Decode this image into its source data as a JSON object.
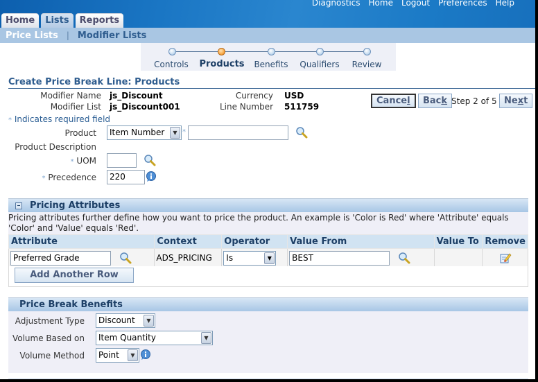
{
  "global_links": [
    "Diagnostics",
    "Home",
    "Logout",
    "Preferences",
    "Help"
  ],
  "tabs": [
    {
      "label": "Home",
      "active": false
    },
    {
      "label": "Lists",
      "active": true
    },
    {
      "label": "Reports",
      "active": false
    }
  ],
  "subnav": {
    "items": [
      {
        "label": "Price Lists",
        "active": true
      },
      {
        "label": "Modifier Lists",
        "active": false
      }
    ],
    "separator": "|"
  },
  "train": {
    "steps": [
      "Controls",
      "Products",
      "Benefits",
      "Qualifiers",
      "Review"
    ],
    "current_index": 1
  },
  "page": {
    "title": "Create Price Break Line: Products",
    "modifier_name_label": "Modifier Name",
    "modifier_name": "js_Discount",
    "modifier_list_label": "Modifier List",
    "modifier_list": "js_Discount001",
    "currency_label": "Currency",
    "currency": "USD",
    "line_number_label": "Line Number",
    "line_number": "511759",
    "required_note": "Indicates required field",
    "required_star": "*"
  },
  "actions": {
    "cancel": {
      "pre": "Cance",
      "accel": "l",
      "post": ""
    },
    "back": {
      "pre": "Bac",
      "accel": "k",
      "post": ""
    },
    "step_text": "Step 2 of 5",
    "next": {
      "pre": "Ne",
      "accel": "x",
      "post": "t"
    }
  },
  "form": {
    "product_label": "Product",
    "product_type": "Item Number",
    "product_value": "",
    "product_description_label": "Product Description",
    "uom_label": "UOM",
    "uom_value": "",
    "precedence_label": "Precedence",
    "precedence_value": "220"
  },
  "pricing_attributes": {
    "title": "Pricing Attributes",
    "description": "Pricing attributes further define how you want to price the product. An example is 'Color is Red' where 'Attribute' equals 'Color' and 'Value' equals 'Red'.",
    "columns": [
      "Attribute",
      "Context",
      "Operator",
      "Value From",
      "Value To",
      "Remove"
    ],
    "rows": [
      {
        "attribute": "Preferred Grade",
        "context": "ADS_PRICING",
        "operator": "Is",
        "value_from": "BEST",
        "value_to": ""
      }
    ],
    "add_row_label": "Add Another Row"
  },
  "price_break_benefits": {
    "title": "Price Break Benefits",
    "adjustment_type_label": "Adjustment Type",
    "adjustment_type": "Discount",
    "volume_based_on_label": "Volume Based on",
    "volume_based_on": "Item Quantity",
    "volume_method_label": "Volume Method",
    "volume_method": "Point"
  },
  "colors": {
    "brand_blue": "#1a76c4",
    "link_blue": "#2f5d8f",
    "current_step": "#f8a948"
  }
}
